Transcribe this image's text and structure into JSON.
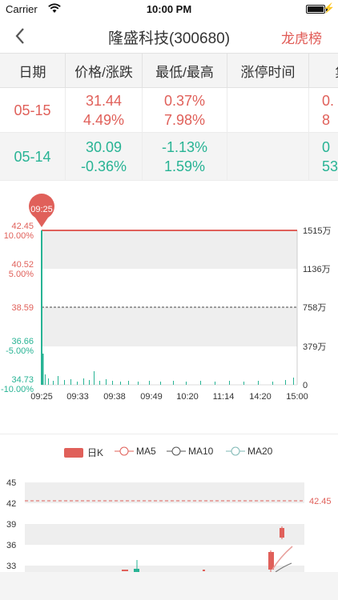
{
  "status_bar": {
    "carrier": "Carrier",
    "time": "10:00 PM"
  },
  "nav": {
    "title": "隆盛科技(300680)",
    "right_link": "龙虎榜"
  },
  "table": {
    "headers": [
      "日期",
      "价格/涨跌",
      "最低/最高",
      "涨停时间",
      "集合"
    ],
    "rows": [
      {
        "date": "05-15",
        "price": "31.44",
        "change": "4.49%",
        "low": "0.37%",
        "high": "7.98%",
        "limit_time": "",
        "auction_top": "0.",
        "auction_bottom": "8"
      },
      {
        "date": "05-14",
        "price": "30.09",
        "change": "-0.36%",
        "low": "-1.13%",
        "high": "1.59%",
        "limit_time": "",
        "auction_top": "0",
        "auction_bottom": "53"
      }
    ]
  },
  "colors": {
    "up": "#e0605a",
    "down": "#27b394",
    "grid_band": "#eeeeee"
  },
  "intraday": {
    "marker_time": "09:25",
    "price_labels": [
      "42.45",
      "40.52",
      "38.59",
      "36.66",
      "34.73"
    ],
    "pct_labels": [
      "10.00%",
      "5.00%",
      "",
      "-5.00%",
      "-10.00%"
    ],
    "volume_labels": [
      "1515万",
      "1136万",
      "758万",
      "379万",
      "0"
    ],
    "time_labels": [
      "09:25",
      "09:33",
      "09:38",
      "09:49",
      "10:20",
      "11:14",
      "14:20",
      "15:00"
    ]
  },
  "legend": {
    "k": "日K",
    "ma5": "MA5",
    "ma10": "MA10",
    "ma20": "MA20"
  },
  "kline": {
    "y_labels": [
      "45",
      "42",
      "39",
      "36",
      "33"
    ],
    "limit_label": "42.45"
  }
}
